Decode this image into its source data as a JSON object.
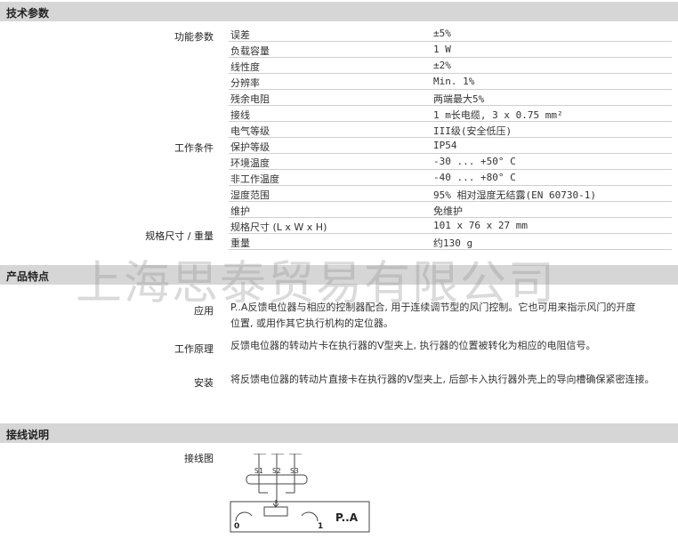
{
  "sections": {
    "tech": "技术参数",
    "features": "产品特点",
    "wiring": "接线说明"
  },
  "groups": {
    "function": "功能参数",
    "working": "工作条件",
    "dimensions": "规格尺寸 / 重量"
  },
  "specs": [
    {
      "k": "误差",
      "v": "±5%"
    },
    {
      "k": "负载容量",
      "v": "1 W"
    },
    {
      "k": "线性度",
      "v": "±2%"
    },
    {
      "k": "分辨率",
      "v": "Min. 1%"
    },
    {
      "k": "残余电阻",
      "v": "两端最大5%"
    },
    {
      "k": "接线",
      "v": "1 m长电缆, 3 x 0.75 mm²"
    },
    {
      "k": "电气等级",
      "v": "III级(安全低压)"
    },
    {
      "k": "保护等级",
      "v": "IP54"
    },
    {
      "k": "环境温度",
      "v": "-30 ... +50° C"
    },
    {
      "k": "非工作温度",
      "v": "-40 ... +80° C"
    },
    {
      "k": "湿度范围",
      "v": "95% 相对湿度无结露(EN 60730-1)"
    },
    {
      "k": "维护",
      "v": "免维护"
    },
    {
      "k": "规格尺寸 (L x W x H)",
      "v": "101 x 76 x 27 mm"
    },
    {
      "k": "重量",
      "v": "约130 g"
    }
  ],
  "features": {
    "application_label": "应用",
    "application_line1": "P..A反馈电位器与相应的控制器配合, 用于连续调节型的风门控制。它也可用来指示风门的开度",
    "application_line2": "位置, 或用作其它执行机构的定位器。",
    "principle_label": "工作原理",
    "principle_text": "反馈电位器的转动片卡在执行器的V型夹上, 执行器的位置被转化为相应的电阻信号。",
    "install_label": "安装",
    "install_text": "将反馈电位器的转动片直接卡在执行器的V型夹上, 后部卡入执行器外壳上的导向槽确保紧密连接。"
  },
  "wiring": {
    "diagram_label": "接线图",
    "s1": "S1",
    "s2": "S2",
    "s3": "S3",
    "pos0": "0",
    "pos1": "1",
    "model": "P..A"
  },
  "watermark": "上海思泰贸易有限公司"
}
